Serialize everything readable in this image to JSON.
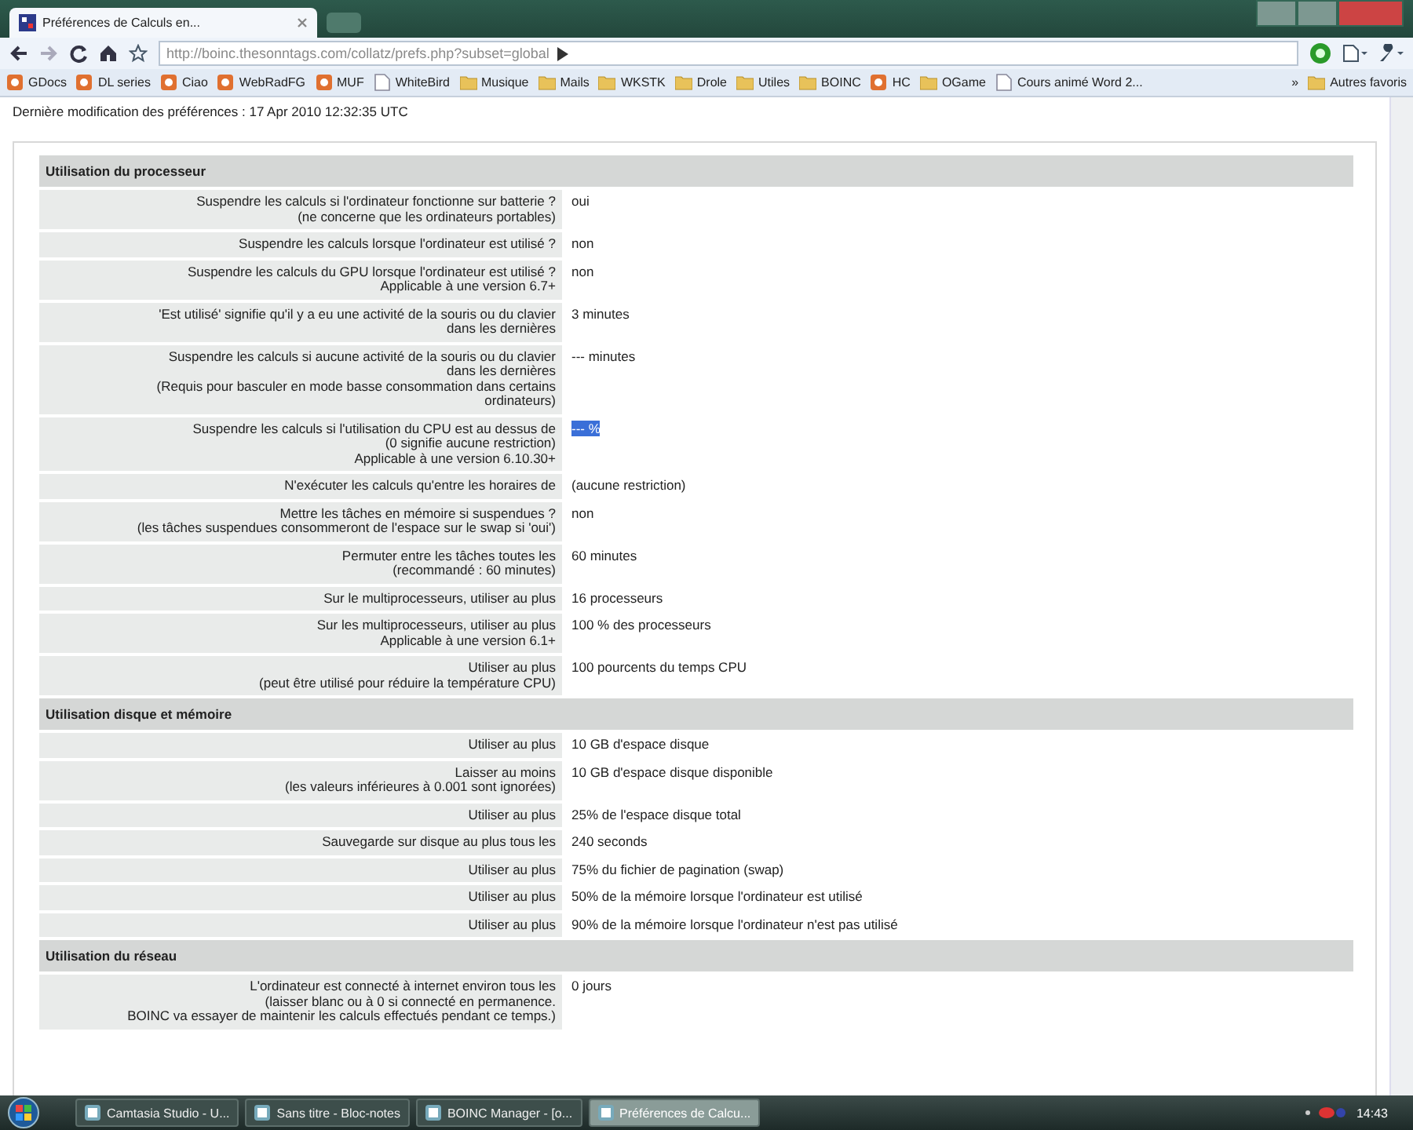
{
  "browser": {
    "tab_title": "Préférences de Calculs en...",
    "url": "http://boinc.thesonntags.com/collatz/prefs.php?subset=global",
    "bookmarks": [
      {
        "label": "GDocs",
        "kind": "site"
      },
      {
        "label": "DL series",
        "kind": "site"
      },
      {
        "label": "Ciao",
        "kind": "site"
      },
      {
        "label": "WebRadFG",
        "kind": "site"
      },
      {
        "label": "MUF",
        "kind": "site"
      },
      {
        "label": "WhiteBird",
        "kind": "page"
      },
      {
        "label": "Musique",
        "kind": "folder"
      },
      {
        "label": "Mails",
        "kind": "folder"
      },
      {
        "label": "WKSTK",
        "kind": "folder"
      },
      {
        "label": "Drole",
        "kind": "folder"
      },
      {
        "label": "Utiles",
        "kind": "folder"
      },
      {
        "label": "BOINC",
        "kind": "folder"
      },
      {
        "label": "HC",
        "kind": "site"
      },
      {
        "label": "OGame",
        "kind": "folder"
      },
      {
        "label": "Cours animé Word 2...",
        "kind": "page"
      }
    ],
    "more": "»",
    "other_bookmarks": "Autres favoris"
  },
  "last_modified": "Dernière modification des préférences : 17 Apr 2010 12:32:35 UTC",
  "sections": [
    {
      "title": "Utilisation du processeur",
      "rows": [
        {
          "label": [
            "Suspendre les calculs si l'ordinateur fonctionne sur batterie ?",
            "(ne concerne que les ordinateurs portables)"
          ],
          "value": "oui",
          "highlighted": false
        },
        {
          "label": [
            "Suspendre les calculs lorsque l'ordinateur est utilisé ?"
          ],
          "value": "non",
          "highlighted": false
        },
        {
          "label": [
            "Suspendre les calculs du GPU lorsque l'ordinateur est utilisé ?",
            "Applicable à une version 6.7+"
          ],
          "value": "non",
          "highlighted": false
        },
        {
          "label": [
            "'Est utilisé' signifie qu'il y a eu une activité de la souris ou du clavier",
            "dans les dernières"
          ],
          "value": "3 minutes",
          "highlighted": false
        },
        {
          "label": [
            "Suspendre les calculs si aucune activité de la souris ou du clavier",
            "dans les dernières",
            "(Requis pour basculer en mode basse consommation dans certains",
            "ordinateurs)"
          ],
          "value": "--- minutes",
          "highlighted": false
        },
        {
          "label": [
            "Suspendre les calculs si l'utilisation du CPU est au dessus de",
            "(0 signifie aucune restriction)",
            "Applicable à une version 6.10.30+"
          ],
          "value": "--- %",
          "highlighted": true
        },
        {
          "label": [
            "N'exécuter les calculs qu'entre les horaires de"
          ],
          "value": "(aucune restriction)",
          "highlighted": false
        },
        {
          "label": [
            "Mettre les tâches en mémoire si suspendues ?",
            "(les tâches suspendues consommeront de l'espace sur le swap si 'oui')"
          ],
          "value": "non",
          "highlighted": false
        },
        {
          "label": [
            "Permuter entre les tâches toutes les",
            "(recommandé : 60 minutes)"
          ],
          "value": "60 minutes",
          "highlighted": false
        },
        {
          "label": [
            "Sur le multiprocesseurs, utiliser au plus"
          ],
          "value": "16 processeurs",
          "highlighted": false
        },
        {
          "label": [
            "Sur les multiprocesseurs, utiliser au plus",
            "Applicable à une version 6.1+"
          ],
          "value": "100 % des processeurs",
          "highlighted": false
        },
        {
          "label": [
            "Utiliser au plus",
            "(peut être utilisé pour réduire la température CPU)"
          ],
          "value": "100 pourcents du temps CPU",
          "highlighted": false
        }
      ]
    },
    {
      "title": "Utilisation disque et mémoire",
      "rows": [
        {
          "label": [
            "Utiliser au plus"
          ],
          "value": "10 GB d'espace disque",
          "highlighted": false
        },
        {
          "label": [
            "Laisser au moins",
            "(les valeurs inférieures à 0.001 sont ignorées)"
          ],
          "value": "10 GB d'espace disque disponible",
          "highlighted": false
        },
        {
          "label": [
            "Utiliser au plus"
          ],
          "value": "25% de l'espace disque total",
          "highlighted": false
        },
        {
          "label": [
            "Sauvegarde sur disque au plus tous les"
          ],
          "value": "240 seconds",
          "highlighted": false
        },
        {
          "label": [
            "Utiliser au plus"
          ],
          "value": "75% du fichier de pagination (swap)",
          "highlighted": false
        },
        {
          "label": [
            "Utiliser au plus"
          ],
          "value": "50% de la mémoire lorsque l'ordinateur est utilisé",
          "highlighted": false
        },
        {
          "label": [
            "Utiliser au plus"
          ],
          "value": "90% de la mémoire lorsque l'ordinateur n'est pas utilisé",
          "highlighted": false
        }
      ]
    },
    {
      "title": "Utilisation du réseau",
      "rows": [
        {
          "label": [
            "L'ordinateur est connecté à internet environ tous les",
            "(laisser blanc ou à 0 si connecté en permanence.",
            "BOINC va essayer de maintenir les calculs effectués pendant ce temps.)"
          ],
          "value": "0 jours",
          "highlighted": false
        }
      ]
    }
  ],
  "taskbar": {
    "items": [
      {
        "label": "Camtasia Studio - U...",
        "selected": false
      },
      {
        "label": "Sans titre - Bloc-notes",
        "selected": false
      },
      {
        "label": "BOINC Manager - [o...",
        "selected": false
      },
      {
        "label": "Préférences de Calcu...",
        "selected": true
      }
    ],
    "clock": "14:43"
  }
}
